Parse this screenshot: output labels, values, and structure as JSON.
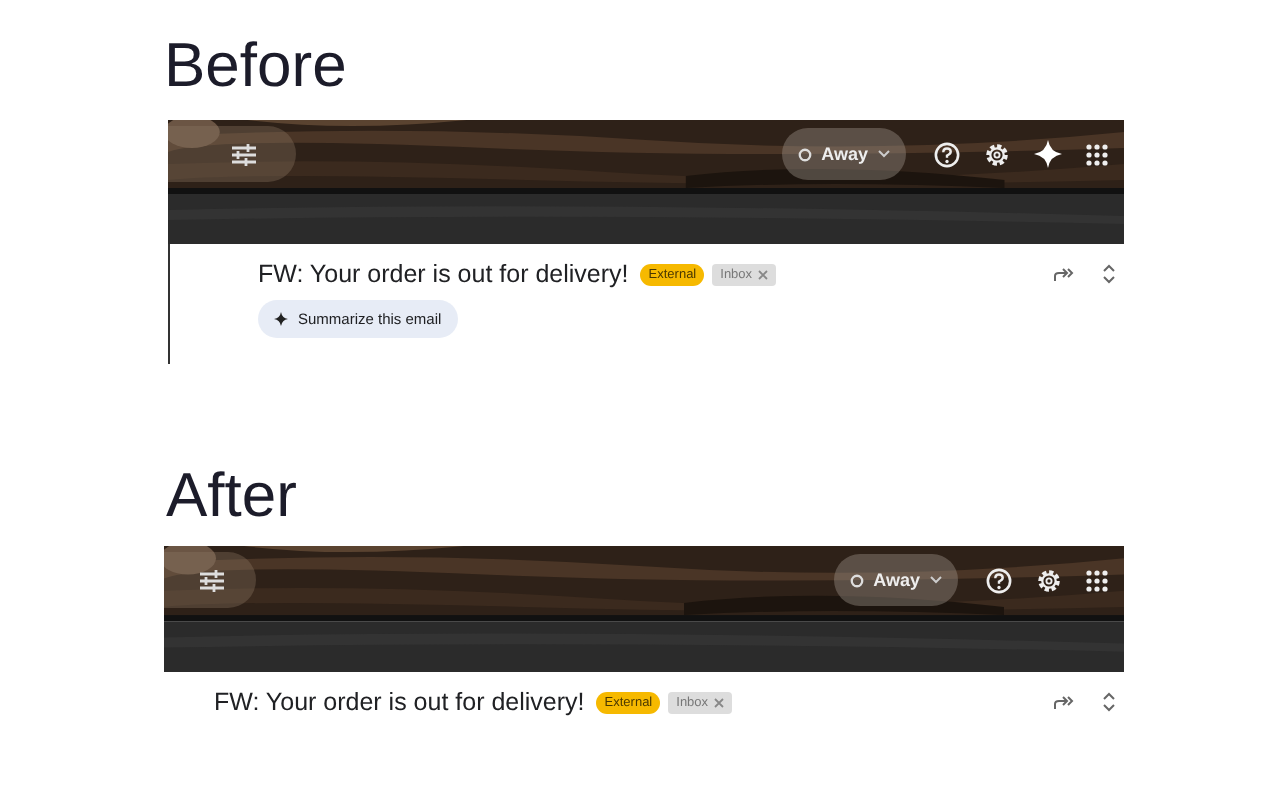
{
  "panels": [
    {
      "heading": "Before",
      "status": "Away",
      "header_icons": [
        {
          "kind": "help"
        },
        {
          "kind": "settings"
        },
        {
          "kind": "sparkle"
        },
        {
          "kind": "apps"
        }
      ],
      "subject": "FW: Your order is out for delivery!",
      "tags": [
        {
          "label": "External",
          "kind": "warning"
        },
        {
          "label": "Inbox",
          "kind": "label"
        }
      ],
      "summary_button": "Summarize this email"
    },
    {
      "heading": "After",
      "status": "Away",
      "header_icons": [
        {
          "kind": "help"
        },
        {
          "kind": "settings"
        },
        {
          "kind": "apps"
        }
      ],
      "subject": "FW: Your order is out for delivery!",
      "tags": [
        {
          "label": "External",
          "kind": "warning"
        },
        {
          "label": "Inbox",
          "kind": "label"
        }
      ]
    }
  ]
}
